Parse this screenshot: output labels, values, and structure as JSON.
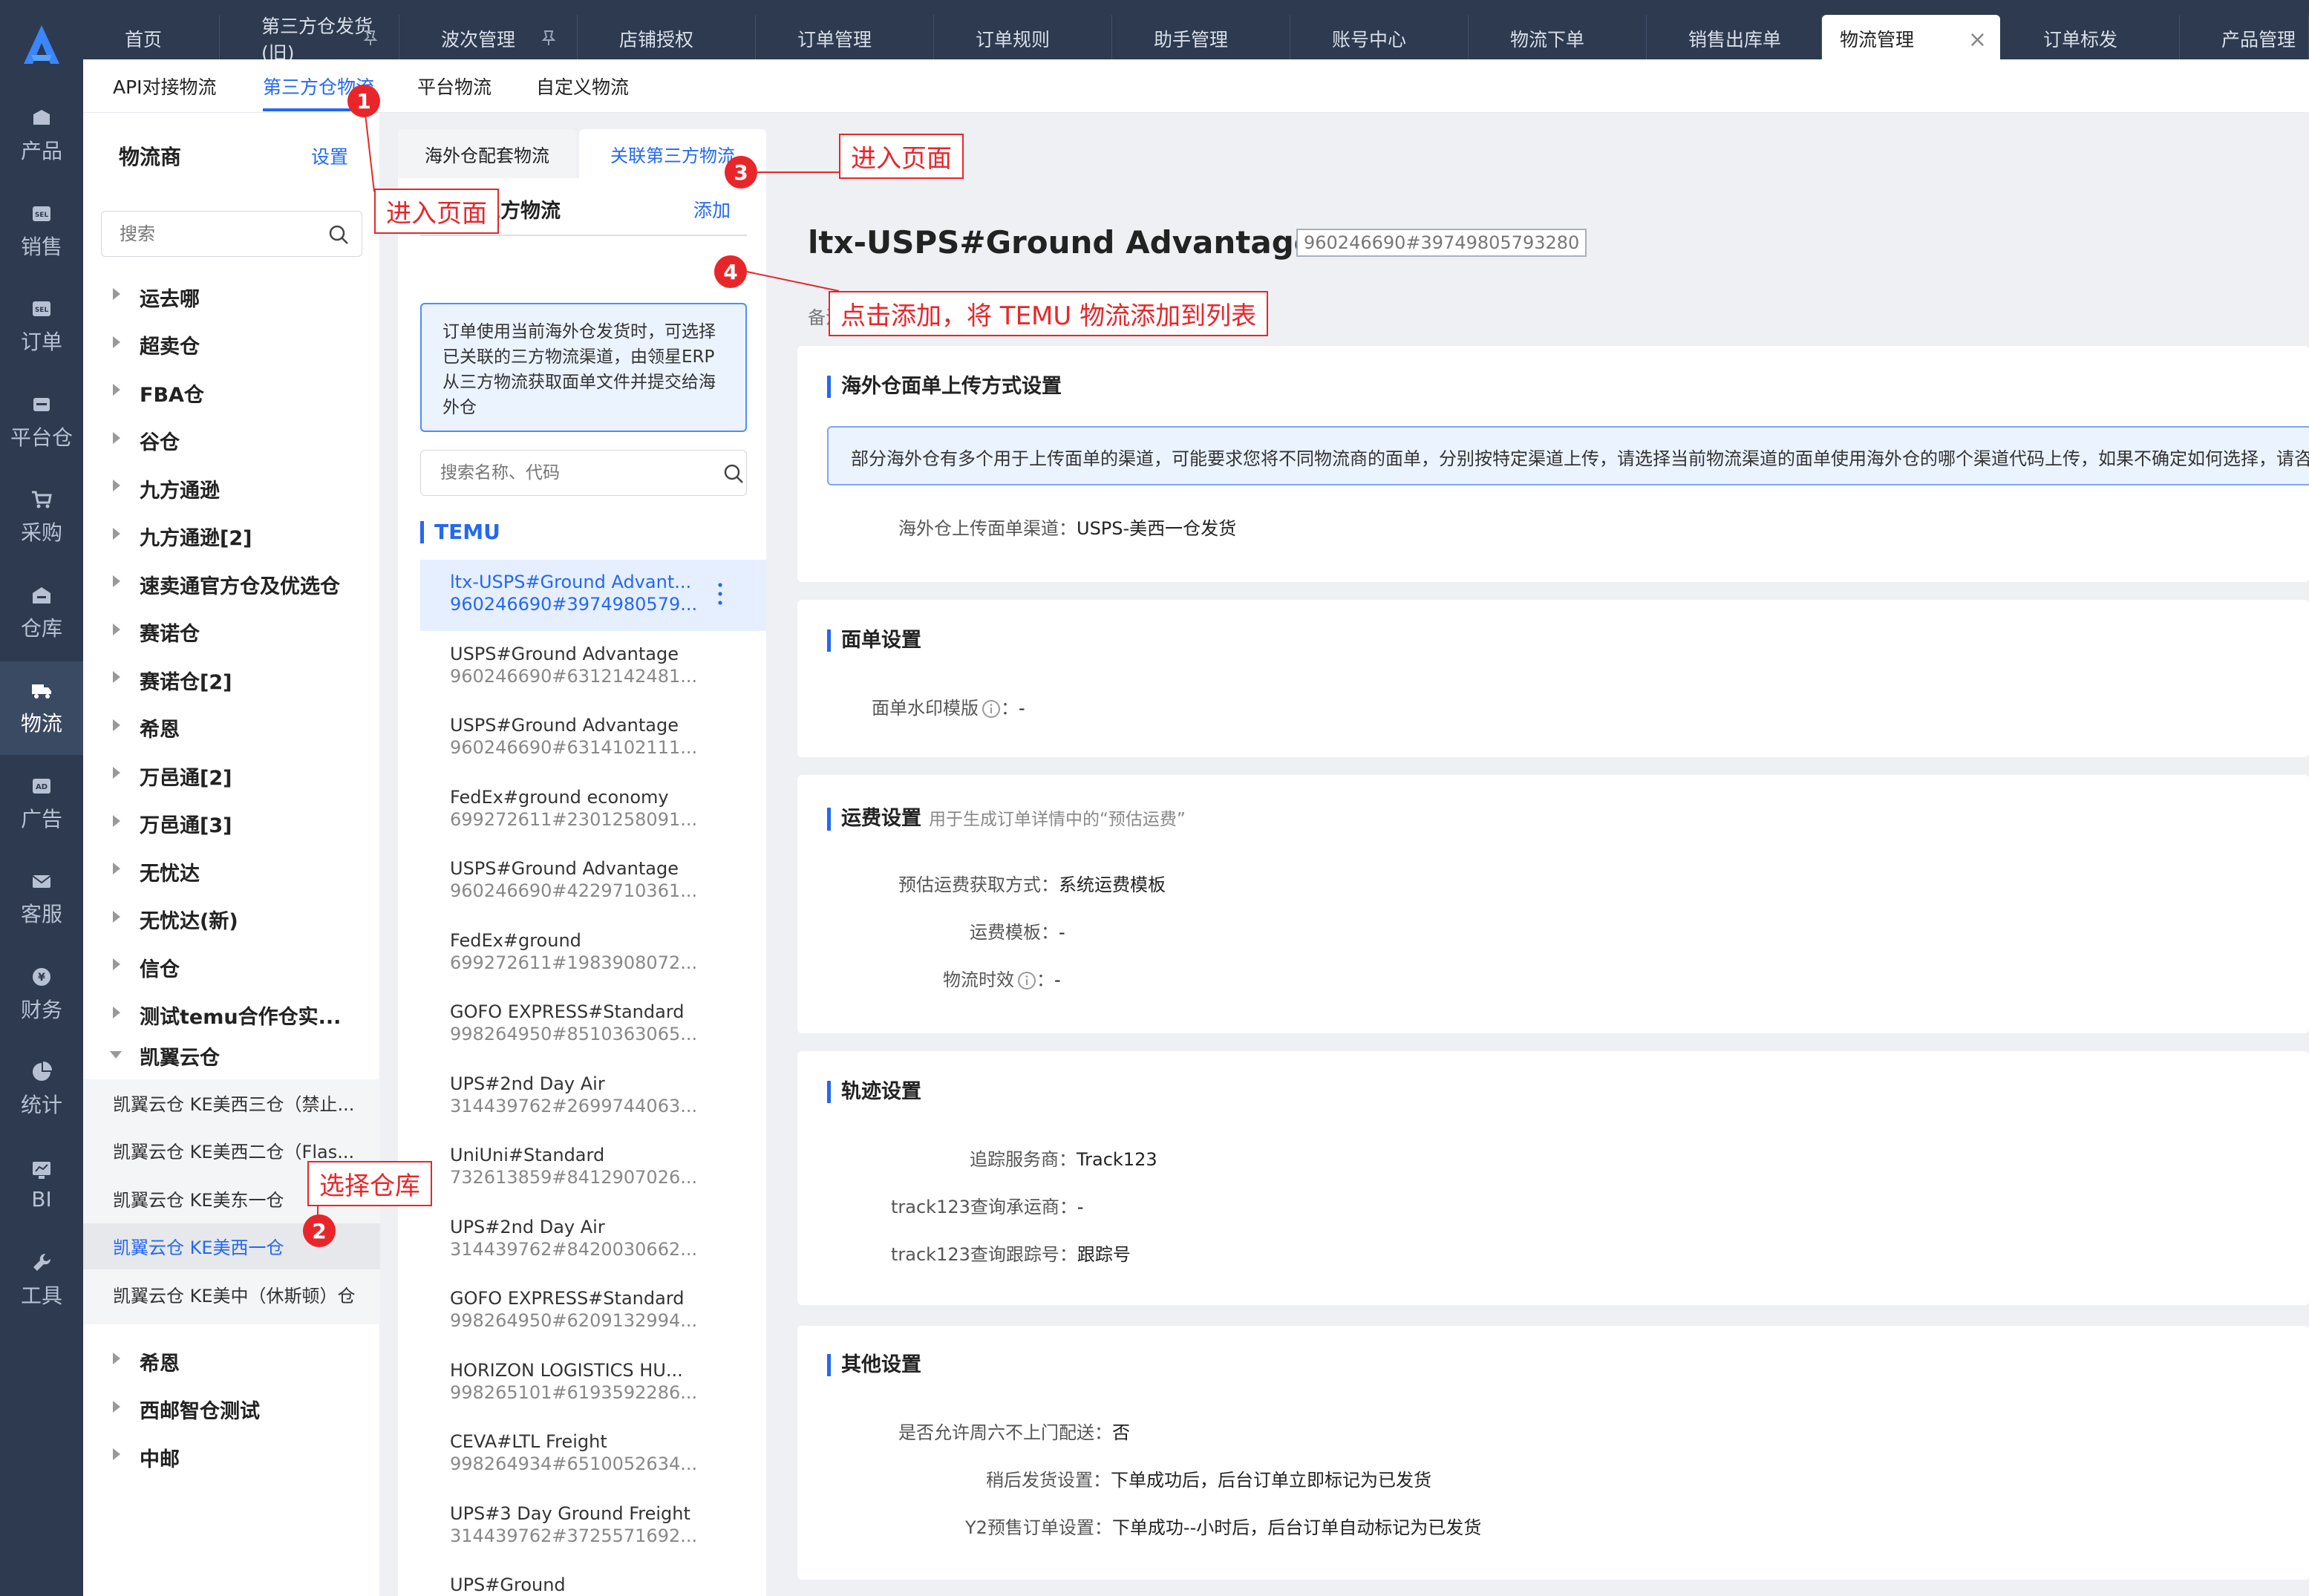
{
  "nav": {
    "items": [
      {
        "label": "产品",
        "icon": "product-icon"
      },
      {
        "label": "销售",
        "icon": "sell-icon"
      },
      {
        "label": "订单",
        "icon": "order-icon"
      },
      {
        "label": "平台仓",
        "icon": "platform-warehouse-icon"
      },
      {
        "label": "采购",
        "icon": "cart-icon"
      },
      {
        "label": "仓库",
        "icon": "warehouse-icon"
      },
      {
        "label": "物流",
        "icon": "truck-icon"
      },
      {
        "label": "广告",
        "icon": "ad-icon"
      },
      {
        "label": "客服",
        "icon": "mail-icon"
      },
      {
        "label": "财务",
        "icon": "yen-icon"
      },
      {
        "label": "统计",
        "icon": "pie-chart-icon"
      },
      {
        "label": "BI",
        "icon": "bi-chart-icon"
      },
      {
        "label": "工具",
        "icon": "wrench-icon"
      }
    ],
    "active_index": 6
  },
  "tabs": [
    {
      "label": "首页"
    },
    {
      "label": "第三方仓发货(旧)"
    },
    {
      "label": "波次管理"
    },
    {
      "label": "店铺授权"
    },
    {
      "label": "订单管理"
    },
    {
      "label": "订单规则"
    },
    {
      "label": "助手管理"
    },
    {
      "label": "账号中心"
    },
    {
      "label": "物流下单"
    },
    {
      "label": "销售出库单"
    },
    {
      "label": "物流管理"
    },
    {
      "label": "订单标发"
    },
    {
      "label": "产品管理"
    }
  ],
  "subtabs": [
    "API对接物流",
    "第三方仓物流",
    "平台物流",
    "自定义物流"
  ],
  "provider": {
    "title": "物流商",
    "settings_label": "设置",
    "search_placeholder": "搜索",
    "items_before": [
      "运去哪",
      "超卖仓",
      "FBA仓",
      "谷仓",
      "九方通逊",
      "九方通逊[2]",
      "速卖通官方仓及优选仓",
      "赛诺仓",
      "赛诺仓[2]",
      "希恩",
      "万邑通[2]",
      "万邑通[3]",
      "无忧达",
      "无忧达(新)",
      "信仓",
      "测试temu合作仓实..."
    ],
    "expanded": "凯翼云仓",
    "children": [
      "凯翼云仓 KE美西三仓（禁止...",
      "凯翼云仓 KE美西二仓（Flas...",
      "凯翼云仓 KE美东一仓",
      "凯翼云仓 KE美西一仓",
      "凯翼云仓 KE美中（休斯顿）仓"
    ],
    "selected_child": 3,
    "items_after": [
      "希恩",
      "西邮智仓测试",
      "中邮"
    ]
  },
  "middle": {
    "tabs": [
      "海外仓配套物流",
      "关联第三方物流"
    ],
    "panel_title": "关联第三方物流",
    "add_label": "添加",
    "info": "订单使用当前海外仓发货时，可选择已关联的三方物流渠道，由领星ERP从三方物流获取面单文件并提交给海外仓",
    "search_placeholder": "搜索名称、代码",
    "group": "TEMU",
    "channels": [
      {
        "name": "ltx-USPS#Ground Advant...",
        "code": "960246690#3974980579..."
      },
      {
        "name": "USPS#Ground Advantage",
        "code": "960246690#6312142481..."
      },
      {
        "name": "USPS#Ground Advantage",
        "code": "960246690#6314102111..."
      },
      {
        "name": "FedEx#ground economy",
        "code": "699272611#2301258091..."
      },
      {
        "name": "USPS#Ground Advantage",
        "code": "960246690#4229710361..."
      },
      {
        "name": "FedEx#ground",
        "code": "699272611#1983908072..."
      },
      {
        "name": "GOFO EXPRESS#Standard",
        "code": "998264950#8510363065..."
      },
      {
        "name": "UPS#2nd Day Air",
        "code": "314439762#2699744063..."
      },
      {
        "name": "UniUni#Standard",
        "code": "732613859#8412907026..."
      },
      {
        "name": "UPS#2nd Day Air",
        "code": "314439762#8420030662..."
      },
      {
        "name": "GOFO EXPRESS#Standard",
        "code": "998264950#6209132994..."
      },
      {
        "name": "HORIZON LOGISTICS HU...",
        "code": "998265101#6193592286..."
      },
      {
        "name": "CEVA#LTL Freight",
        "code": "998264934#6510052634..."
      },
      {
        "name": "UPS#3 Day Ground Freight",
        "code": "314439762#3725571692..."
      },
      {
        "name": "UPS#Ground",
        "code": ""
      }
    ],
    "selected_channel": 0
  },
  "detail": {
    "title": "ltx-USPS#Ground Advantage",
    "code": "960246690#39749805793280",
    "remark_label": "备注",
    "sections": {
      "upload": {
        "title": "海外仓面单上传方式设置",
        "notice": "部分海外仓有多个用于上传面单的渠道，可能要求您将不同物流商的面单，分别按特定渠道上传，请选择当前物流渠道的面单使用海外仓的哪个渠道代码上传，如果不确定如何选择，请咨",
        "k1": "海外仓上传面单渠道：",
        "v1": "USPS-美西一仓发货"
      },
      "label": {
        "title": "面单设置",
        "k1": "面单水印模版",
        "sep": "：",
        "v1": "-"
      },
      "freight": {
        "title": "运费设置",
        "subtitle": "用于生成订单详情中的“预估运费”",
        "k1": "预估运费获取方式：",
        "v1": "系统运费模板",
        "k2": "运费模板：",
        "v2": "-",
        "k3": "物流时效",
        "v3": "-"
      },
      "track": {
        "title": "轨迹设置",
        "k1": "追踪服务商：",
        "v1": "Track123",
        "k2": "track123查询承运商：",
        "v2": "-",
        "k3": "track123查询跟踪号：",
        "v3": "跟踪号"
      },
      "other": {
        "title": "其他设置",
        "k1": "是否允许周六不上门配送：",
        "v1": "否",
        "k2": "稍后发货设置：",
        "v2": "下单成功后，后台订单立即标记为已发货",
        "k3": "Y2预售订单设置：",
        "v3": "下单成功--小时后，后台订单自动标记为已发货"
      }
    }
  },
  "annotations": [
    {
      "num": "1",
      "text": "进入页面"
    },
    {
      "num": "2",
      "text": "选择仓库"
    },
    {
      "num": "3",
      "text": "进入页面"
    },
    {
      "num": "4",
      "text": "点击添加，将 TEMU 物流添加到列表"
    }
  ],
  "colors": {
    "nav_bg": "#2d3a4f",
    "accent": "#2468f2",
    "annotation": "#e8262a",
    "page_bg": "#eef0f4"
  }
}
